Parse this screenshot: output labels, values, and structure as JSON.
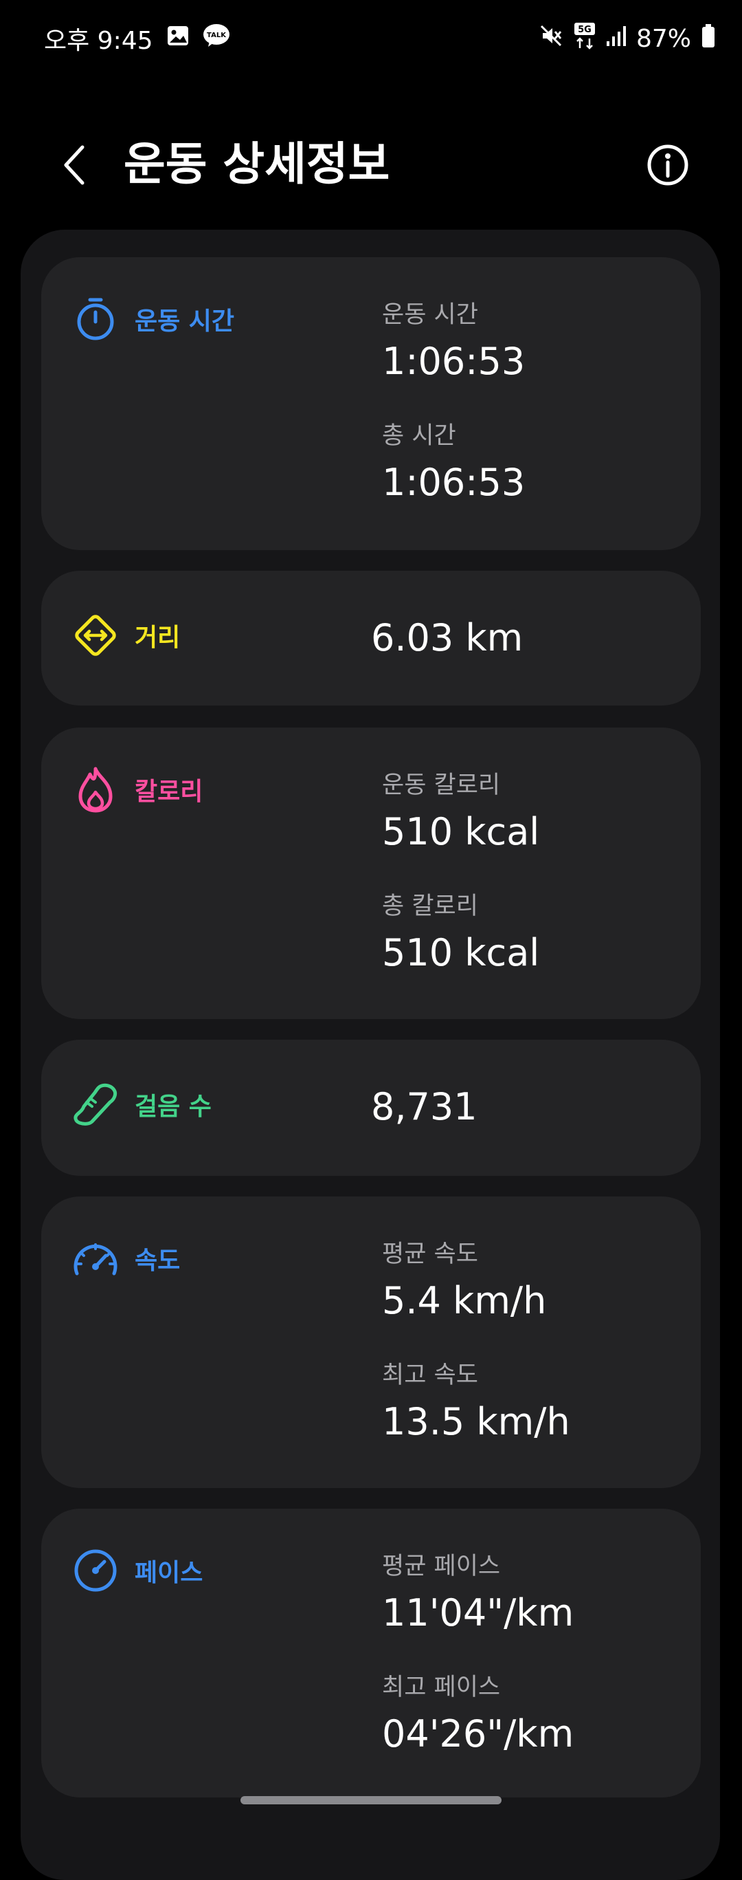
{
  "status_bar": {
    "time": "오후 9:45",
    "network": "5G",
    "battery": "87%"
  },
  "header": {
    "title": "운동 상세정보"
  },
  "colors": {
    "blue": "#3d8cf0",
    "yellow": "#f5e620",
    "pink": "#ff4fa0",
    "green": "#43d38a"
  },
  "cards": {
    "duration": {
      "label": "운동 시간",
      "items": [
        {
          "label": "운동 시간",
          "value": "1:06:53"
        },
        {
          "label": "총 시간",
          "value": "1:06:53"
        }
      ]
    },
    "distance": {
      "label": "거리",
      "value": "6.03 km"
    },
    "calories": {
      "label": "칼로리",
      "items": [
        {
          "label": "운동 칼로리",
          "value": "510 kcal"
        },
        {
          "label": "총 칼로리",
          "value": "510 kcal"
        }
      ]
    },
    "steps": {
      "label": "걸음 수",
      "value": "8,731"
    },
    "speed": {
      "label": "속도",
      "items": [
        {
          "label": "평균 속도",
          "value": "5.4 km/h"
        },
        {
          "label": "최고 속도",
          "value": "13.5 km/h"
        }
      ]
    },
    "pace": {
      "label": "페이스",
      "items": [
        {
          "label": "평균 페이스",
          "value": "11'04\"/km"
        },
        {
          "label": "최고 페이스",
          "value": "04'26\"/km"
        }
      ]
    }
  }
}
